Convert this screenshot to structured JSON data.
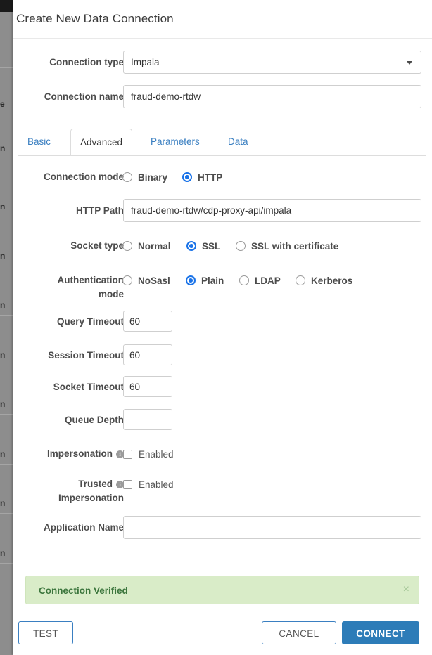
{
  "dialog": {
    "title": "Create New Data Connection"
  },
  "top_fields": {
    "connection_type_label": "Connection type",
    "connection_type_value": "Impala",
    "connection_name_label": "Connection name",
    "connection_name_value": "fraud-demo-rtdw"
  },
  "tabs": [
    {
      "label": "Basic",
      "active": false
    },
    {
      "label": "Advanced",
      "active": true
    },
    {
      "label": "Parameters",
      "active": false
    },
    {
      "label": "Data",
      "active": false
    }
  ],
  "advanced": {
    "connection_mode": {
      "label": "Connection mode",
      "options": [
        {
          "label": "Binary",
          "selected": false
        },
        {
          "label": "HTTP",
          "selected": true
        }
      ]
    },
    "http_path": {
      "label": "HTTP Path",
      "value": "fraud-demo-rtdw/cdp-proxy-api/impala"
    },
    "socket_type": {
      "label": "Socket type",
      "options": [
        {
          "label": "Normal",
          "selected": false
        },
        {
          "label": "SSL",
          "selected": true
        },
        {
          "label": "SSL with certificate",
          "selected": false
        }
      ]
    },
    "auth_mode": {
      "label_line1": "Authentication",
      "label_line2": "mode",
      "options": [
        {
          "label": "NoSasl",
          "selected": false
        },
        {
          "label": "Plain",
          "selected": true
        },
        {
          "label": "LDAP",
          "selected": false
        },
        {
          "label": "Kerberos",
          "selected": false
        }
      ]
    },
    "query_timeout": {
      "label": "Query Timeout",
      "value": "60"
    },
    "session_timeout": {
      "label": "Session Timeout",
      "value": "60"
    },
    "socket_timeout": {
      "label": "Socket Timeout",
      "value": "60"
    },
    "queue_depth": {
      "label": "Queue Depth",
      "value": ""
    },
    "impersonation": {
      "label": "Impersonation",
      "info": "i",
      "checkbox_label": "Enabled",
      "checked": false
    },
    "trusted_impersonation": {
      "label_line1": "Trusted",
      "label_line2": "Impersonation",
      "info": "i",
      "checkbox_label": "Enabled",
      "checked": false
    },
    "application_name": {
      "label": "Application Name",
      "value": ""
    }
  },
  "alert": {
    "message": "Connection Verified",
    "close_icon": "×"
  },
  "footer": {
    "test_label": "TEST",
    "cancel_label": "CANCEL",
    "connect_label": "CONNECT"
  },
  "colors": {
    "accent_blue": "#2d7cb8",
    "link_blue": "#3a7fc1",
    "radio_blue": "#1a73e8",
    "alert_bg": "#d9ecc8",
    "alert_text": "#3c763d"
  },
  "backdrop": {
    "fragments": [
      "n",
      "e",
      "n",
      "n",
      "n",
      "n",
      "n",
      "n",
      "n",
      "n",
      "n"
    ]
  }
}
